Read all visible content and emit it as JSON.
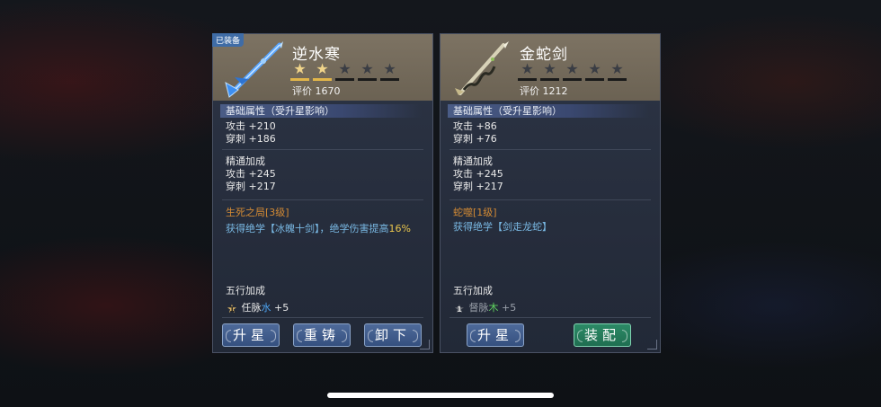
{
  "left": {
    "equipped_badge": "已装备",
    "name": "逆水寒",
    "stars_filled": 2,
    "stars_total": 5,
    "score": "评价 1670",
    "base_title": "基础属性（受升星影响）",
    "base_attack": "攻击 +210",
    "base_pierce": "穿刺 +186",
    "mastery_title": "精通加成",
    "mastery_attack": "攻击 +245",
    "mastery_pierce": "穿刺 +217",
    "skill_name": "生死之局[3级]",
    "skill_desc_a": "获得绝学【冰魄十剑】，绝学伤害提高",
    "skill_desc_num": "16%",
    "element_title": "五行加成",
    "element_star": "1",
    "element_pre": "任脉",
    "element_el": "水",
    "element_val": " +5",
    "buttons": [
      "升星",
      "重铸",
      "卸下"
    ]
  },
  "right": {
    "name": "金蛇剑",
    "stars_filled": 0,
    "stars_total": 5,
    "score": "评价 1212",
    "base_title": "基础属性（受升星影响）",
    "base_attack": "攻击 +86",
    "base_pierce": "穿刺 +76",
    "mastery_title": "精通加成",
    "mastery_attack": "攻击 +245",
    "mastery_pierce": "穿刺 +217",
    "skill_name": "蛇噬[1级]",
    "skill_desc": "获得绝学【剑走龙蛇】",
    "element_title": "五行加成",
    "element_star": "1",
    "element_pre": "督脉",
    "element_el": "木",
    "element_val": " +5",
    "buttons": [
      "升星",
      "装配"
    ]
  },
  "colors": {
    "accent_gold": "#e2b64a",
    "water": "#4da3f0",
    "wood": "#5ed15e",
    "skill_name": "#d48b34",
    "skill_desc": "#79b8e3"
  }
}
